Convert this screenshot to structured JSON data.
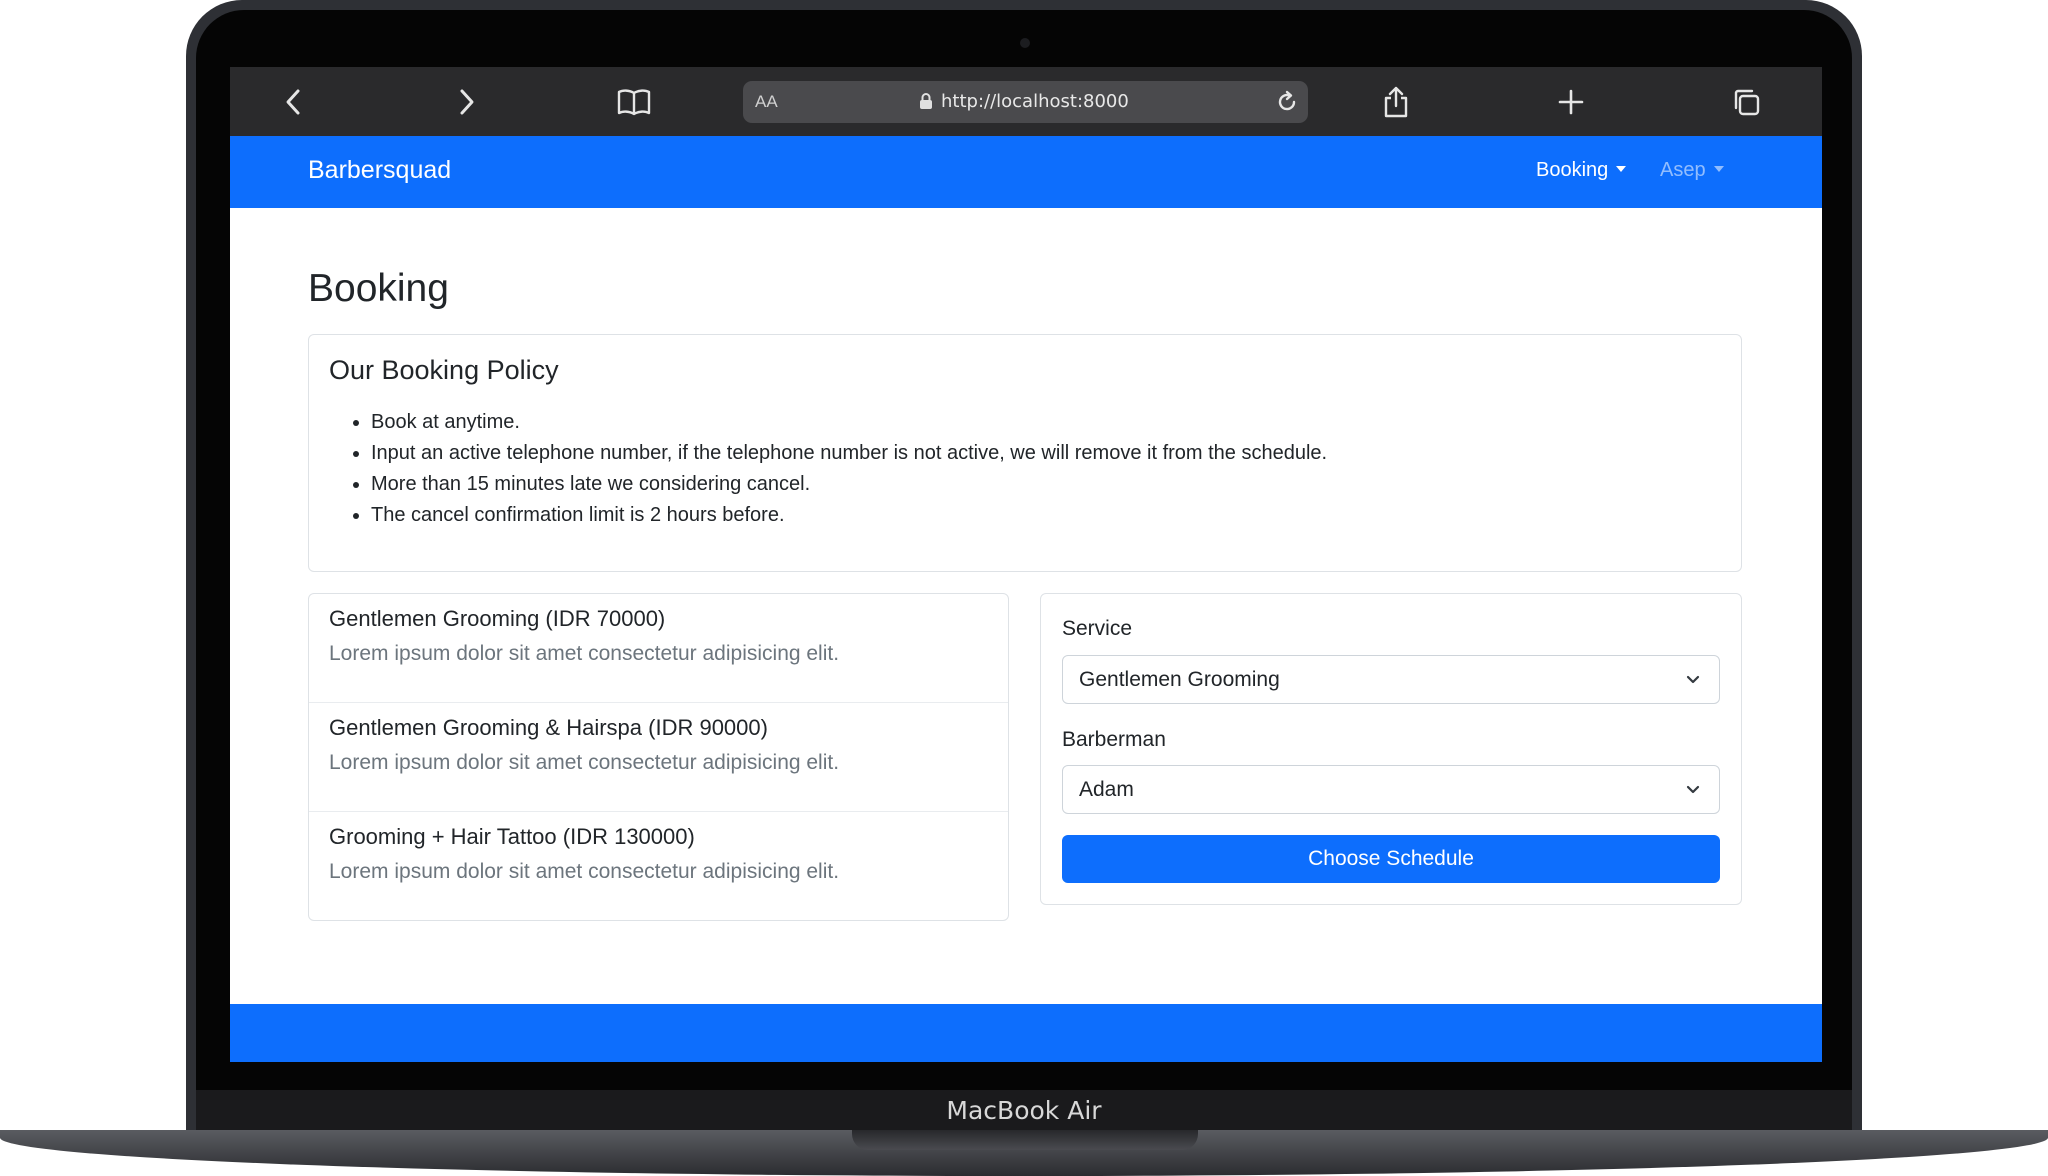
{
  "device": {
    "model_label": "MacBook Air"
  },
  "browser": {
    "url_aa": "AA",
    "url": "http://localhost:8000"
  },
  "navbar": {
    "brand": "Barbersquad",
    "items": [
      {
        "label": "Booking"
      },
      {
        "label": "Asep"
      }
    ]
  },
  "page": {
    "title": "Booking"
  },
  "policy": {
    "title": "Our Booking Policy",
    "items": [
      "Book at anytime.",
      "Input an active telephone number, if the telephone number is not active, we will remove it from the schedule.",
      "More than 15 minutes late we considering cancel.",
      "The cancel confirmation limit is 2 hours before."
    ]
  },
  "services": [
    {
      "name": "Gentlemen Grooming (IDR 70000)",
      "description": "Lorem ipsum dolor sit amet consectetur adipisicing elit."
    },
    {
      "name": "Gentlemen Grooming & Hairspa (IDR 90000)",
      "description": "Lorem ipsum dolor sit amet consectetur adipisicing elit."
    },
    {
      "name": "Grooming + Hair Tattoo (IDR 130000)",
      "description": "Lorem ipsum dolor sit amet consectetur adipisicing elit."
    }
  ],
  "form": {
    "service_label": "Service",
    "service_value": "Gentlemen Grooming",
    "barber_label": "Barberman",
    "barber_value": "Adam",
    "submit_label": "Choose Schedule"
  },
  "colors": {
    "primary": "#0d6efd",
    "toolbar": "#2a2a2c",
    "muted_text": "#6c757d"
  }
}
